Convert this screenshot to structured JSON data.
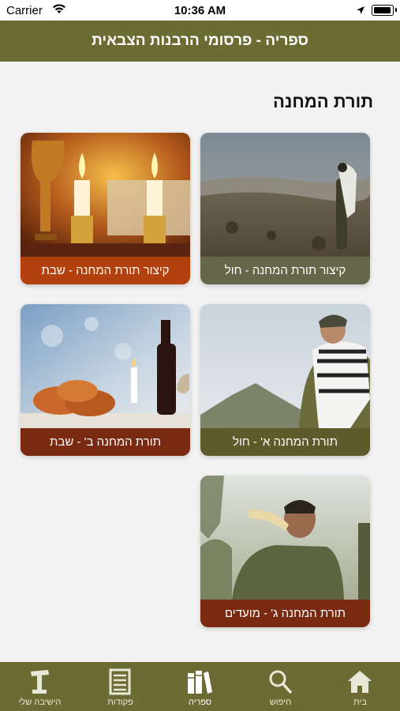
{
  "status_bar": {
    "carrier": "Carrier",
    "time": "10:36 AM"
  },
  "header": {
    "title": "ספריה - פרסומי הרבנות הצבאית"
  },
  "section": {
    "title": "תורת המחנה"
  },
  "cards": [
    {
      "label": "קיצור תורת המחנה - חול",
      "label_color": "#66664a"
    },
    {
      "label": "קיצור תורת המחנה - שבת",
      "label_color": "#b3410f"
    },
    {
      "label": "תורת המחנה א' - חול",
      "label_color": "#5f5a2a"
    },
    {
      "label": "תורת המחנה ב' - שבת",
      "label_color": "#7a2a10"
    },
    {
      "label": "תורת המחנה ג' - מועדים",
      "label_color": "#7a2a10"
    }
  ],
  "tabs": [
    {
      "label": "בית",
      "icon": "home-icon"
    },
    {
      "label": "חיפוש",
      "icon": "search-icon"
    },
    {
      "label": "ספריה",
      "icon": "books-icon",
      "active": true
    },
    {
      "label": "פקודות",
      "icon": "orders-icon"
    },
    {
      "label": "הישיבה שלי",
      "icon": "lectern-icon"
    }
  ],
  "colors": {
    "brand": "#6b6b33",
    "background": "#f2f2f2"
  }
}
